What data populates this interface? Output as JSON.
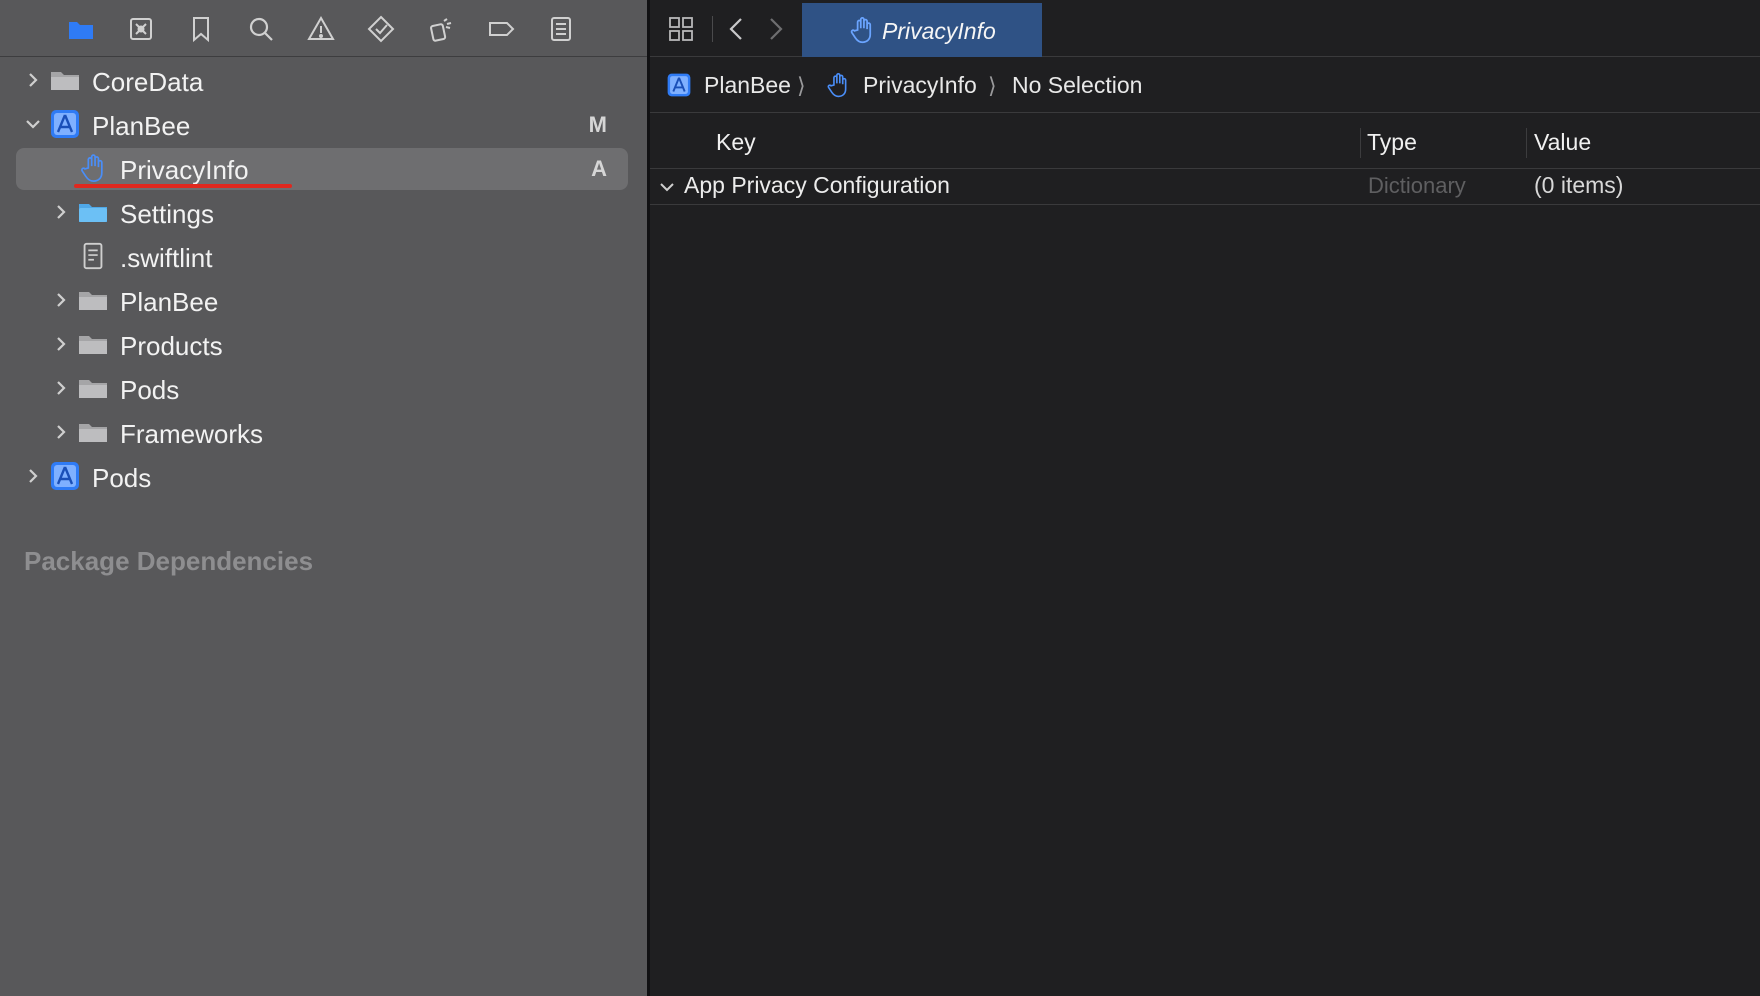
{
  "navigator": {
    "toolbar_icons": [
      "folder-icon",
      "source-control-icon",
      "bookmark-icon",
      "search-icon",
      "warning-icon",
      "test-icon",
      "debug-icon",
      "breakpoint-icon",
      "report-icon"
    ],
    "tree": [
      {
        "label": "CoreData",
        "icon": "folder-icon",
        "badge": ""
      },
      {
        "label": "PlanBee",
        "icon": "project-icon",
        "badge": "M"
      },
      {
        "label": "PrivacyInfo",
        "icon": "hand-icon",
        "badge": "A"
      },
      {
        "label": "Settings",
        "icon": "bundle-icon",
        "badge": ""
      },
      {
        "label": ".swiftlint",
        "icon": "file-icon",
        "badge": ""
      },
      {
        "label": "PlanBee",
        "icon": "folder-icon",
        "badge": ""
      },
      {
        "label": "Products",
        "icon": "folder-icon",
        "badge": ""
      },
      {
        "label": "Pods",
        "icon": "folder-icon",
        "badge": ""
      },
      {
        "label": "Frameworks",
        "icon": "folder-icon",
        "badge": ""
      },
      {
        "label": "Pods",
        "icon": "project-icon",
        "badge": ""
      }
    ],
    "section_title": "Package Dependencies"
  },
  "editor": {
    "active_tab": "PrivacyInfo",
    "breadcrumb": [
      "PlanBee",
      "PrivacyInfo",
      "No Selection"
    ],
    "columns": {
      "key": "Key",
      "type": "Type",
      "value": "Value"
    },
    "rows": [
      {
        "key": "App Privacy Configuration",
        "type": "Dictionary",
        "value": "(0 items)"
      }
    ]
  },
  "colors": {
    "accent": "#2f7bf5",
    "selection": "#6e6e70",
    "navigator_bg": "#58585a",
    "editor_bg": "#1f1f21",
    "tab_active": "#2f5285",
    "annotation_underline": "#e0281e"
  }
}
